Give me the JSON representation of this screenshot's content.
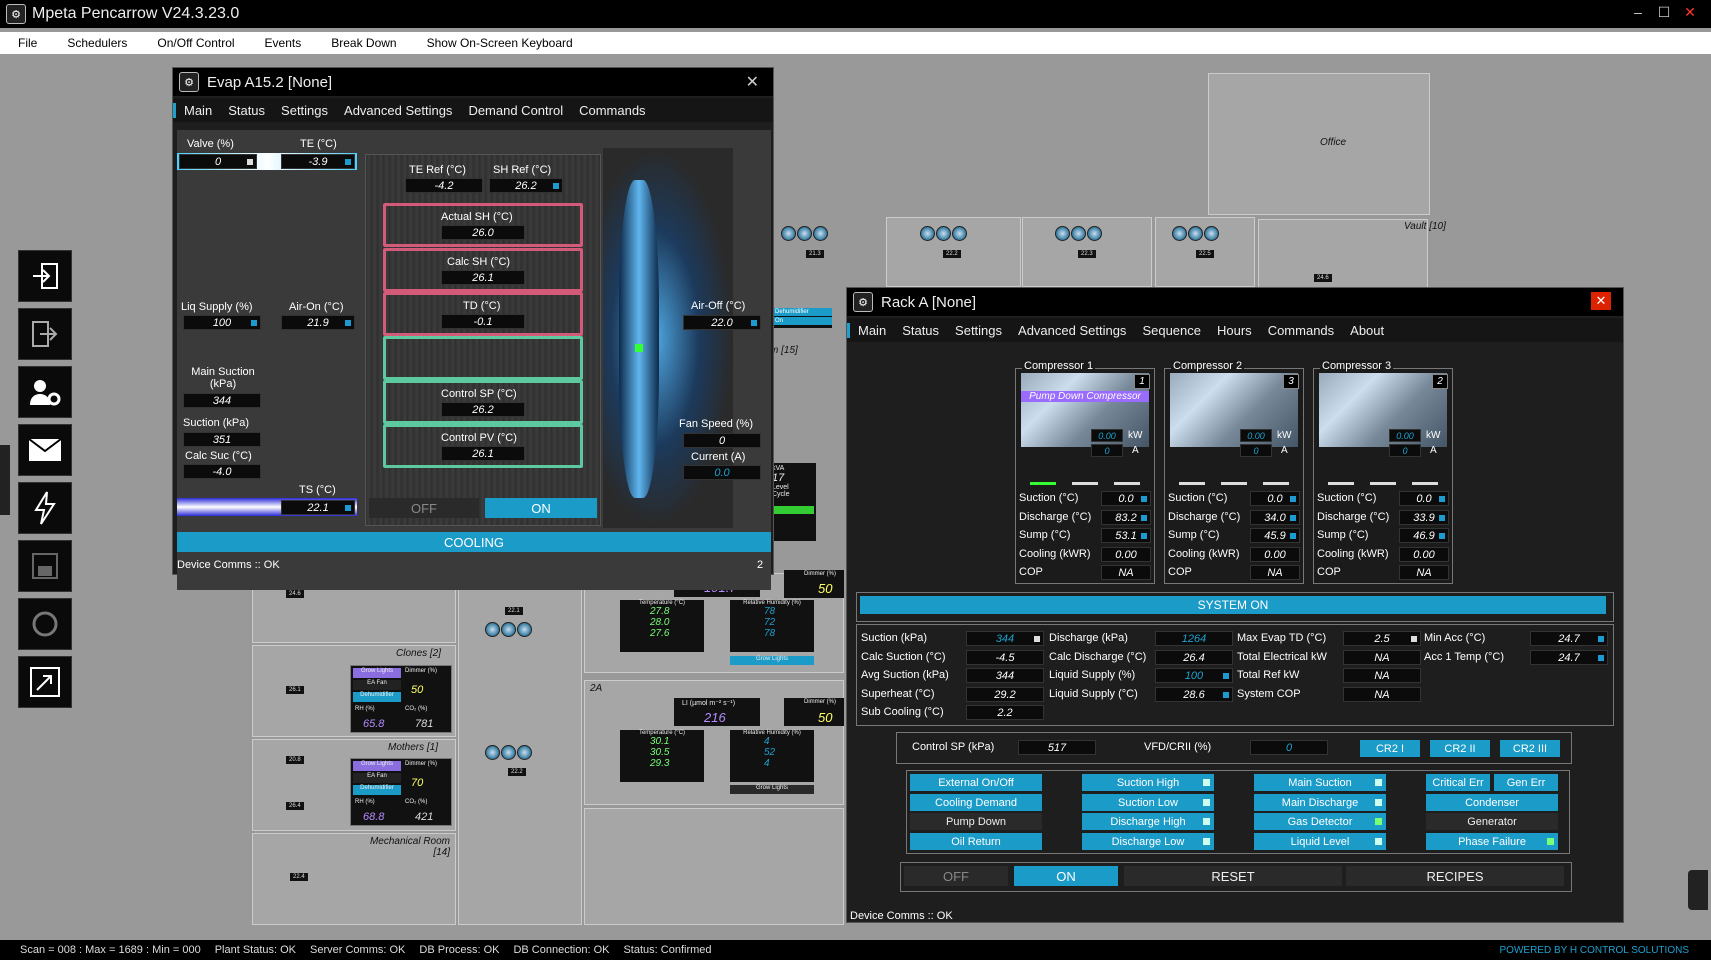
{
  "app": {
    "title": "Mpeta Pencarrow V24.3.23.0"
  },
  "menu": [
    "File",
    "Schedulers",
    "On/Off Control",
    "Events",
    "Break Down",
    "Show On-Screen Keyboard"
  ],
  "sidebar": [
    "login-icon",
    "logout-icon",
    "user-settings-icon",
    "mail-icon",
    "lightning-icon",
    "save-icon",
    "refresh-icon",
    "resize-icon"
  ],
  "background": {
    "office": "Office",
    "vault": "Vault [10]",
    "room15": "m [15]",
    "clones": "Clones [2]",
    "mothers": "Mothers [1]",
    "mechanical": "Mechanical Room [14]",
    "room2a": "2A",
    "dehumidifier": "Dehumidifier",
    "grow_lights": "Grow Lights",
    "ea_fan": "EA Fan",
    "rh": "RH (%)",
    "co2": "CO₂ (%)",
    "dimmer": "Dimmer (%)",
    "clones_dimmer": "50",
    "clones_rh": "65.8",
    "clones_co2": "781",
    "mothers_dimmer": "70",
    "mothers_rh": "68.8",
    "mothers_co2": "421",
    "top_dimmer": "50",
    "top_li": "191.7",
    "li_label": "LI (µmol m⁻² s⁻¹)",
    "li_2a": "216",
    "dimmer_2a": "50",
    "temp_label": "Temperature (°C)",
    "rh_label": "Relative Humidity (%)",
    "temps_top": [
      "27.8",
      "28.0",
      "27.6"
    ],
    "rh_top": [
      "78",
      "72",
      "78"
    ],
    "temps_2a": [
      "30.1",
      "30.5",
      "29.3"
    ],
    "rh_2a": [
      "4",
      "52",
      "4"
    ],
    "small": {
      "a": "17",
      "b": "kVA",
      "c": "Level",
      "d": "Cycle"
    },
    "fan_vals": [
      "21.3",
      "22.2",
      "22.3",
      "22.5",
      "24.6",
      "22.1",
      "24.6",
      "26.1",
      "20.8",
      "26.4",
      "22.4",
      "22.2"
    ],
    "on": "On"
  },
  "evap": {
    "title": "Evap A15.2 [None]",
    "tabs": [
      "Main",
      "Status",
      "Settings",
      "Advanced Settings",
      "Demand Control",
      "Commands"
    ],
    "valve_label": "Valve (%)",
    "valve": "0",
    "te_label": "TE (°C)",
    "te": "-3.9",
    "te_ref_label": "TE Ref (°C)",
    "te_ref": "-4.2",
    "sh_ref_label": "SH Ref (°C)",
    "sh_ref": "26.2",
    "actual_sh_label": "Actual SH (°C)",
    "actual_sh": "26.0",
    "calc_sh_label": "Calc SH (°C)",
    "calc_sh": "26.1",
    "td_label": "TD (°C)",
    "td": "-0.1",
    "control_sp_label": "Control SP (°C)",
    "control_sp": "26.2",
    "control_pv_label": "Control PV (°C)",
    "control_pv": "26.1",
    "liq_supply_label": "Liq Supply (%)",
    "liq_supply": "100",
    "air_on_label": "Air-On (°C)",
    "air_on": "21.9",
    "air_off_label": "Air-Off (°C)",
    "air_off": "22.0",
    "main_suction_label": "Main Suction (kPa)",
    "main_suction": "344",
    "suction_label": "Suction (kPa)",
    "suction": "351",
    "calc_suc_label": "Calc Suc (°C)",
    "calc_suc": "-4.0",
    "ts_label": "TS (°C)",
    "ts": "22.1",
    "fan_speed_label": "Fan Speed (%)",
    "fan_speed": "0",
    "current_label": "Current (A)",
    "current": "0.0",
    "off": "OFF",
    "on": "ON",
    "status": "COOLING",
    "comms": "Device Comms :: OK",
    "page": "2"
  },
  "rack": {
    "title": "Rack A [None]",
    "tabs": [
      "Main",
      "Status",
      "Settings",
      "Advanced Settings",
      "Sequence",
      "Hours",
      "Commands",
      "About"
    ],
    "compressors": [
      {
        "name": "Compressor 1",
        "num": "1",
        "banner": "Pump Down Compressor",
        "kw": "0.00",
        "a": "0",
        "suction": "0.0",
        "discharge": "83.2",
        "sump": "53.1",
        "cooling": "0.00",
        "cop": "NA"
      },
      {
        "name": "Compressor 2",
        "num": "3",
        "banner": "",
        "kw": "0.00",
        "a": "0",
        "suction": "0.0",
        "discharge": "34.0",
        "sump": "45.9",
        "cooling": "0.00",
        "cop": "NA"
      },
      {
        "name": "Compressor 3",
        "num": "2",
        "banner": "",
        "kw": "0.00",
        "a": "0",
        "suction": "0.0",
        "discharge": "33.9",
        "sump": "46.9",
        "cooling": "0.00",
        "cop": "NA"
      }
    ],
    "comp_labels": {
      "kw": "kW",
      "a": "A",
      "suction": "Suction (°C)",
      "discharge": "Discharge (°C)",
      "sump": "Sump (°C)",
      "cooling": "Cooling (kWR)",
      "cop": "COP"
    },
    "system": "SYSTEM ON",
    "metrics": [
      {
        "label": "Suction (kPa)",
        "value": "344",
        "style": "blue"
      },
      {
        "label": "Calc Suction (°C)",
        "value": "-4.5"
      },
      {
        "label": "Avg Suction (kPa)",
        "value": "344"
      },
      {
        "label": "Superheat (°C)",
        "value": "29.2"
      },
      {
        "label": "Sub Cooling (°C)",
        "value": "2.2"
      },
      {
        "label": "Discharge (kPa)",
        "value": "1264",
        "style": "blue"
      },
      {
        "label": "Calc Discharge (°C)",
        "value": "26.4"
      },
      {
        "label": "Liquid Supply (%)",
        "value": "100",
        "style": "blue"
      },
      {
        "label": "Liquid Supply (°C)",
        "value": "28.6"
      },
      {
        "label": "Max Evap TD (°C)",
        "value": "2.5"
      },
      {
        "label": "Total Electrical kW",
        "value": "NA"
      },
      {
        "label": "Total Ref kW",
        "value": "NA"
      },
      {
        "label": "System COP",
        "value": "NA"
      },
      {
        "label": "Min Acc (°C)",
        "value": "24.7"
      },
      {
        "label": "Acc 1 Temp (°C)",
        "value": "24.7"
      }
    ],
    "control_sp_label": "Control SP (kPa)",
    "control_sp": "517",
    "vfd_label": "VFD/CRII (%)",
    "vfd": "0",
    "cr": [
      "CR2 I",
      "CR2 II",
      "CR2 III"
    ],
    "alarms": [
      [
        "External On/Off",
        "Cooling Demand",
        "Pump Down",
        "Oil Return"
      ],
      [
        "Suction High",
        "Suction Low",
        "Discharge High",
        "Discharge Low"
      ],
      [
        "Main Suction",
        "Main Discharge",
        "Gas Detector",
        "Liquid Level"
      ],
      [
        "Critical Err",
        "Gen Err",
        "Condenser",
        "Generator",
        "Phase Failure"
      ]
    ],
    "off": "OFF",
    "on": "ON",
    "reset": "RESET",
    "recipes": "RECIPES",
    "comms": "Device Comms :: OK"
  },
  "status": {
    "scan": "Scan = 008 : Max = 1689 : Min = 000",
    "plant": "Plant Status: OK",
    "server": "Server Comms: OK",
    "db_process": "DB Process: OK",
    "db_conn": "DB Connection: OK",
    "status": "Status: Confirmed",
    "powered": "POWERED BY H CONTROL SOLUTIONS"
  },
  "colors": {
    "accent": "#1b9bc8",
    "alarm_pipe": "#d45a7a",
    "ok_pipe": "#5cc9a0",
    "purple": "#9a6bff"
  }
}
